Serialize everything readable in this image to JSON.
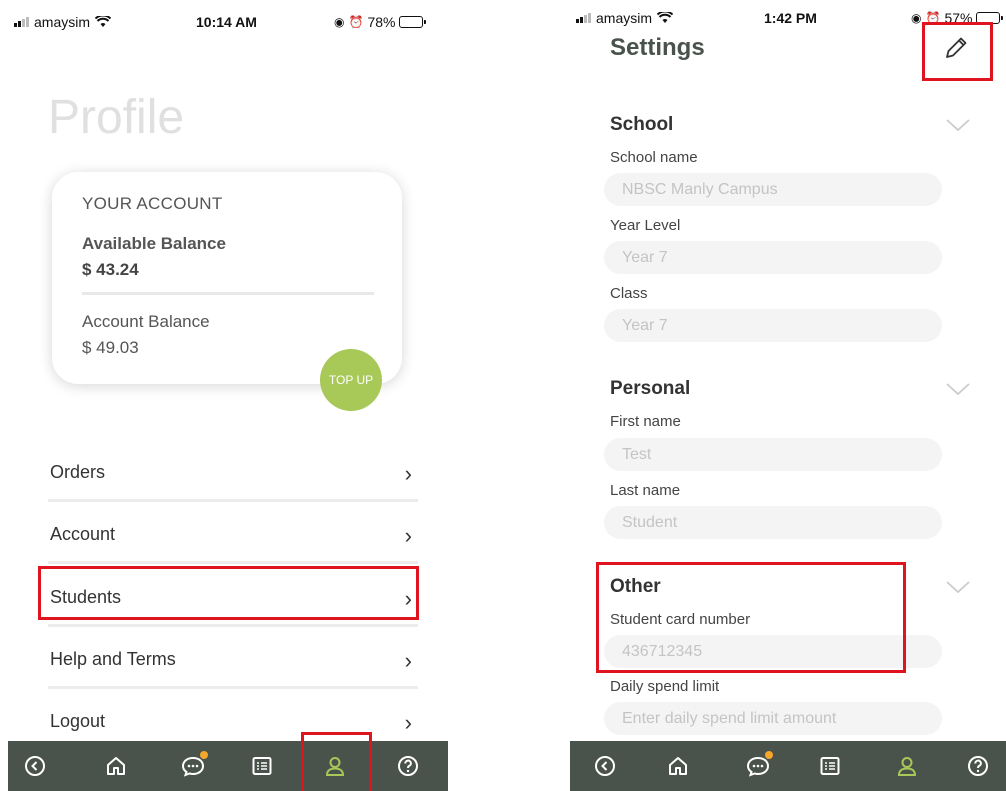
{
  "left": {
    "status": {
      "carrier": "amaysim",
      "time": "10:14 AM",
      "battery": "78%",
      "battery_level": 0.78
    },
    "title": "Profile",
    "account_card": {
      "heading": "YOUR ACCOUNT",
      "available_label": "Available Balance",
      "available_value": "$ 43.24",
      "balance_label": "Account Balance",
      "balance_value": "$ 49.03",
      "topup_label": "TOP UP"
    },
    "menu": [
      {
        "label": "Orders"
      },
      {
        "label": "Account"
      },
      {
        "label": "Students"
      },
      {
        "label": "Help and Terms"
      },
      {
        "label": "Logout"
      }
    ]
  },
  "right": {
    "status": {
      "carrier": "amaysim",
      "time": "1:42 PM",
      "battery": "57%",
      "battery_level": 0.57
    },
    "title": "Settings",
    "school": {
      "heading": "School",
      "school_name_label": "School name",
      "school_name_value": "NBSC Manly Campus",
      "year_level_label": "Year Level",
      "year_level_value": "Year 7",
      "class_label": "Class",
      "class_value": "Year 7"
    },
    "personal": {
      "heading": "Personal",
      "first_name_label": "First name",
      "first_name_value": "Test",
      "last_name_label": "Last name",
      "last_name_value": "Student"
    },
    "other": {
      "heading": "Other",
      "card_label": "Student card number",
      "card_value": "436712345",
      "limit_label": "Daily spend limit",
      "limit_placeholder": "Enter daily spend limit amount"
    }
  },
  "icons": {
    "tabbar": [
      "back-icon",
      "home-icon",
      "chat-icon",
      "list-icon",
      "profile-icon",
      "help-icon"
    ],
    "edit": "pencil-icon",
    "chevron": "chevron-right-icon",
    "section_chevron": "chevron-down-icon"
  },
  "colors": {
    "tabbar_bg": "#4a524c",
    "accent_green": "#a8c858",
    "notification_dot": "#f4a72a",
    "highlight_red": "#e0141e"
  }
}
